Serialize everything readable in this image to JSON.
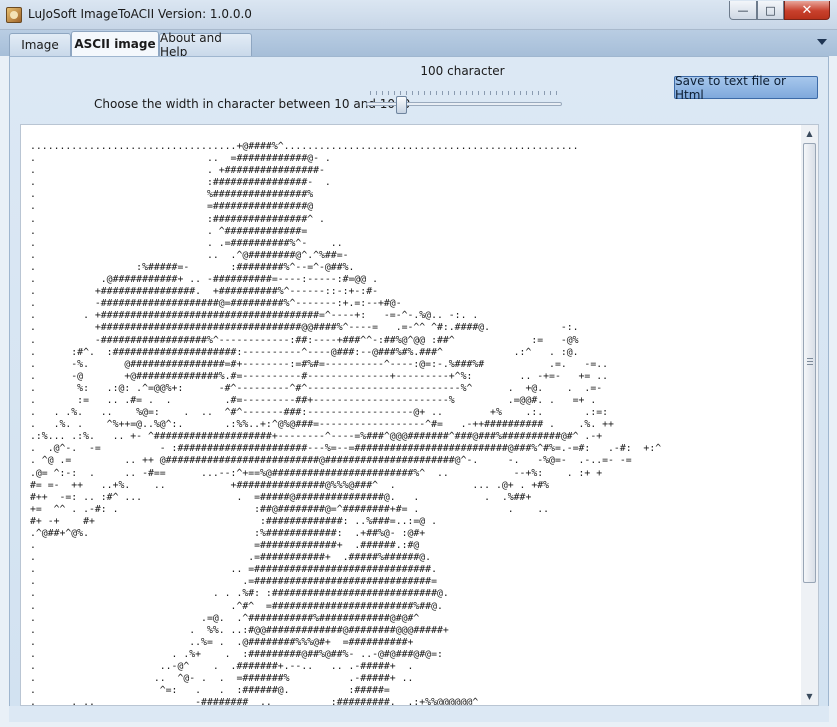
{
  "window": {
    "title": "LuJoSoft ImageToACII Version: 1.0.0.0",
    "minimize_label": "—",
    "maximize_label": "□",
    "close_label": "✕"
  },
  "tabs": [
    {
      "label": "Image"
    },
    {
      "label": "ASCII image"
    },
    {
      "label": "About and Help"
    }
  ],
  "controls": {
    "width_label": "Choose the width in character between 10 and 1000",
    "char_count": "100 character",
    "slider_value": 100,
    "slider_min": 10,
    "slider_max": 1000,
    "save_button": "Save to text file or Html"
  },
  "ascii": {
    "text": "...................................+@####%^..................................................\n.                             ..  =############@- .\n.                             . +################-\n.                             :################-  .\n.                             %################%\n.                             =################@\n.                             :################^ .\n.                             . ^#############=\n.                             . .=##########%^-    ..\n.                             ..  .^@########@^.^%##=-\n.                 :%#####=-       :########%^--=^-@##%.\n.           .@###########+ .. -##########=----:-----:#=@@ .\n.          +################.  +##########%^------::-:+-:#-\n.          -####################@=#########%^-------:+.=:--+#@-\n.        . +#####################################=^----+:   -=-^-.%@.. -:. .\n.          +##################################@@####%^----=   .=-^^ ^#:.####@.            -:.\n.          -##################%^------------:##:----+###^^-:##%@^@@ :##^             :=   -@%\n.      :#^.  :#####################:----------^----@###:--@###%#%.###^            .:^   . :@.\n.      -%.      @################=#+--------:=#%#=----------^----:@=:-.%###%#           .=.   -=..\n.      -@       +@##############%.#=----------#--------------+---------+^%:        .. -+=-   += ..\n.       %:   .:@: .^=@@%+:      -#^---------^#^--------------------------%^      .  +@.    .  .=-\n.       :=   .. .#= .  .         .#=---------##+-----------------------%         .=@@#. .   =+ .\n.   . .%.   ..    %@=:    .  ..  ^#^-------###:------------------@+ ..        +%    .:.       .:=:\n.   .%. .    ^%++=@..%@^:.       .:%%..+:^@%@###=------------------^#=   .-++########## .    .%. ++\n.:%... .:%.   .. +- ^####################+--------^----=%###^@@@#######^###@###%##########@#^ .-+\n.  .@^-.  -=          - :######################---%=--=##########################@###%^#%=.-=#:   .-#:  +:^\n. ^@ .=         .. ++ @##########################@######################@^-.     -.   -%@=-  .-..=- -=\n.@= ^:-:  .     .. -#==      ...--:^+==%@########################%^  ..           --+%:    . :+ +\n#= =-  ++   ..+%.    ..           +###############@%%%@###^  .             ... .@+ . +#%\n#++  -=: .. :#^ ...                .  =#####@###############@.   .           .  .%##+\n+=  ^^ . .-#: .                       :##@########@=^########+#= .               .    ..\n#+ -+    #+                            :#############: ..%###=..:=@ .\n.^@##+^@%.                            :%############:  .+##%@- :@#+\n.                                     =#############+  .######.:#@\n.                                    .=###########+  .#####%######@.\n.                                 .. =##############################.\n.                                   .=##############################=\n.                              . . .%#: :############################@.\n.                                 .^#^  =########################%##@.\n.                            .=@.  .^###########%############@#@#^\n.                          .  %%. ..:#@@#############@########@@@#####+\n.                          ..%= .  .@########%%%@#+  =##########+\n.                       . .%+    .  :#########@##%@##%- ..-@#@###@#@=:\n.                     ..-@^    .  .#######+.--..   .. .-#####+  .\n.                    ..  ^@- .  .  =#######%          .-#####+ ..\n.                     ^=:   .   .  :######@.          :#####=\n.      . ..                 -########  ..          :#########.  .:+%%@@@@@@^\n.     ..^+:...-+++-      .+-@######.  ..          .#=+#####@++#=+++++++++++#= .\n.                        -#@#########=              =###@#@=+##@@@@@@@@@@@@#"
  }
}
